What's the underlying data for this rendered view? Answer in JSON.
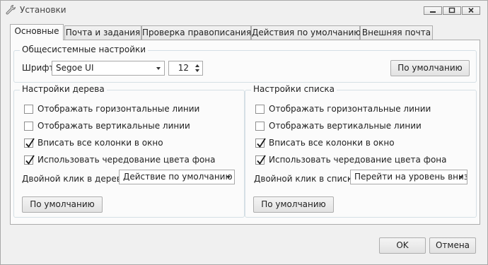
{
  "window": {
    "title": "Установки"
  },
  "tabs": [
    {
      "label": "Основные",
      "active": true
    },
    {
      "label": "Почта и задания",
      "active": false
    },
    {
      "label": "Проверка правописания",
      "active": false
    },
    {
      "label": "Действия по умолчанию",
      "active": false
    },
    {
      "label": "Внешняя почта",
      "active": false
    }
  ],
  "system": {
    "title": "Общесистемные настройки",
    "font_label": "Шрифт:",
    "font_value": "Segoe UI",
    "size_value": "12",
    "default_button": "По умолчанию"
  },
  "tree": {
    "title": "Настройки дерева",
    "checks": [
      {
        "label": "Отображать горизонтальные линии",
        "checked": false
      },
      {
        "label": "Отображать вертикальные линии",
        "checked": false
      },
      {
        "label": "Вписать все колонки в окно",
        "checked": true
      },
      {
        "label": "Использовать чередование цвета фона",
        "checked": true
      }
    ],
    "dbl_label": "Двойной клик в дереве:",
    "dbl_value": "Действие по умолчанию",
    "default_button": "По умолчанию"
  },
  "list": {
    "title": "Настройки списка",
    "checks": [
      {
        "label": "Отображать горизонтальные линии",
        "checked": false
      },
      {
        "label": "Отображать вертикальные линии",
        "checked": false
      },
      {
        "label": "Вписать все колонки в окно",
        "checked": true
      },
      {
        "label": "Использовать чередование цвета фона",
        "checked": true
      }
    ],
    "dbl_label": "Двойной клик в списке:",
    "dbl_value": "Перейти на уровень вниз",
    "default_button": "По умолчанию"
  },
  "footer": {
    "ok": "OK",
    "cancel": "Отмена"
  }
}
